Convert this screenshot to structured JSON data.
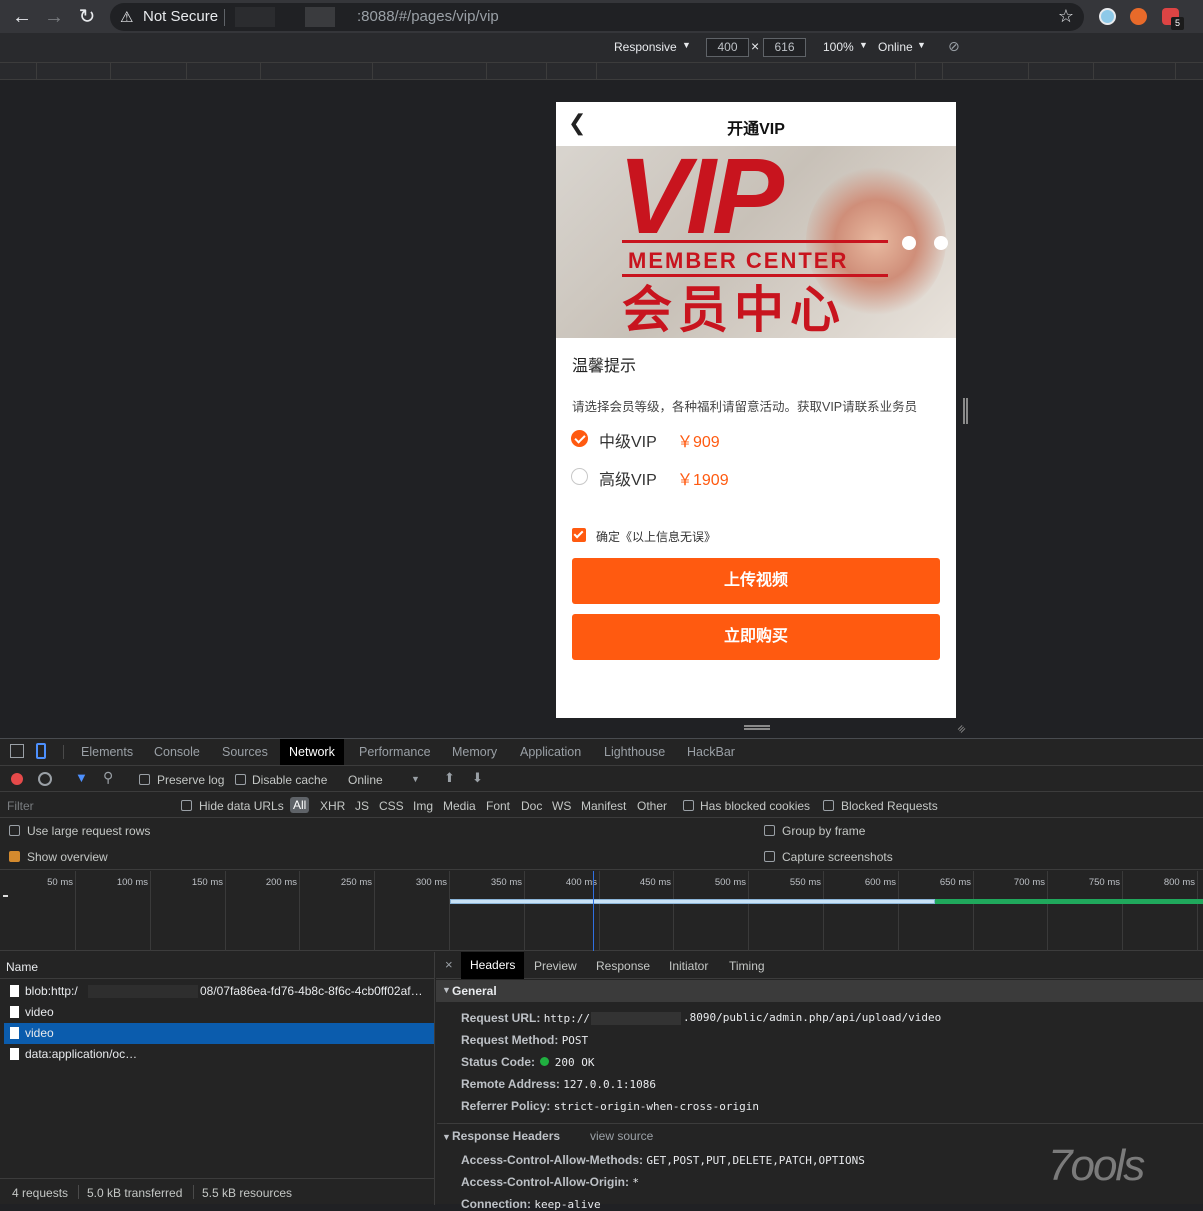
{
  "browser": {
    "security_label": "Not Secure",
    "url": ":8088/#/pages/vip/vip",
    "extension_badge": "5"
  },
  "device_toolbar": {
    "device": "Responsive",
    "width": "400",
    "height": "616",
    "zoom": "100%",
    "throttle": "Online"
  },
  "page": {
    "title": "开通VIP",
    "banner": {
      "big_text": "VIP",
      "sub_text": "MEMBER CENTER",
      "cn_text": "会员中心"
    },
    "tips_title": "温馨提示",
    "tips_text": "请选择会员等级，各种福利请留意活动。获取VIP请联系业务员",
    "options": [
      {
        "name": "中级VIP",
        "price": "￥909",
        "selected": true
      },
      {
        "name": "高级VIP",
        "price": "￥1909",
        "selected": false
      }
    ],
    "agree_text": "确定《以上信息无误》",
    "upload_button": "上传视频",
    "buy_button": "立即购买",
    "accent_color": "#ff5a10"
  },
  "devtools": {
    "tabs": [
      "Elements",
      "Console",
      "Sources",
      "Network",
      "Performance",
      "Memory",
      "Application",
      "Lighthouse",
      "HackBar"
    ],
    "active_tab": "Network",
    "toolbar": {
      "preserve_log": "Preserve log",
      "disable_cache": "Disable cache",
      "throttle": "Online"
    },
    "filter": {
      "placeholder": "Filter",
      "hide_data_urls": "Hide data URLs",
      "types": [
        "All",
        "XHR",
        "JS",
        "CSS",
        "Img",
        "Media",
        "Font",
        "Doc",
        "WS",
        "Manifest",
        "Other"
      ],
      "has_blocked_cookies": "Has blocked cookies",
      "blocked_requests": "Blocked Requests"
    },
    "options": {
      "large_rows": "Use large request rows",
      "show_overview": "Show overview",
      "group_by_frame": "Group by frame",
      "capture_screenshots": "Capture screenshots"
    },
    "timeline_ticks": [
      "50 ms",
      "100 ms",
      "150 ms",
      "200 ms",
      "250 ms",
      "300 ms",
      "350 ms",
      "400 ms",
      "450 ms",
      "500 ms",
      "550 ms",
      "600 ms",
      "650 ms",
      "700 ms",
      "750 ms",
      "800 ms"
    ],
    "requests_header": "Name",
    "requests": [
      {
        "name": "blob:http:/",
        "name_tail": "08/07fa86ea-fd76-4b8c-8f6c-4cb0ff02af…",
        "selected": false
      },
      {
        "name": "video",
        "name_tail": "",
        "selected": false
      },
      {
        "name": "video",
        "name_tail": "",
        "selected": true
      },
      {
        "name": "data:application/oc…",
        "name_tail": "",
        "selected": false
      }
    ],
    "detail_tabs": [
      "Headers",
      "Preview",
      "Response",
      "Initiator",
      "Timing"
    ],
    "general_title": "General",
    "general": [
      {
        "key": "Request URL:",
        "value": "http://",
        "value_tail": ".8090/public/admin.php/api/upload/video"
      },
      {
        "key": "Request Method:",
        "value": "POST",
        "value_tail": ""
      },
      {
        "key": "Status Code:",
        "value": "200 OK",
        "value_tail": ""
      },
      {
        "key": "Remote Address:",
        "value": "127.0.0.1:1086",
        "value_tail": ""
      },
      {
        "key": "Referrer Policy:",
        "value": "strict-origin-when-cross-origin",
        "value_tail": ""
      }
    ],
    "response_headers_title": "Response Headers",
    "view_source": "view source",
    "response_headers": [
      {
        "key": "Access-Control-Allow-Methods:",
        "value": "GET,POST,PUT,DELETE,PATCH,OPTIONS"
      },
      {
        "key": "Access-Control-Allow-Origin:",
        "value": "*"
      },
      {
        "key": "Connection:",
        "value": "keep-alive"
      }
    ],
    "status_bar": {
      "requests": "4 requests",
      "transferred": "5.0 kB transferred",
      "resources": "5.5 kB resources"
    },
    "watermark": "7ools"
  }
}
